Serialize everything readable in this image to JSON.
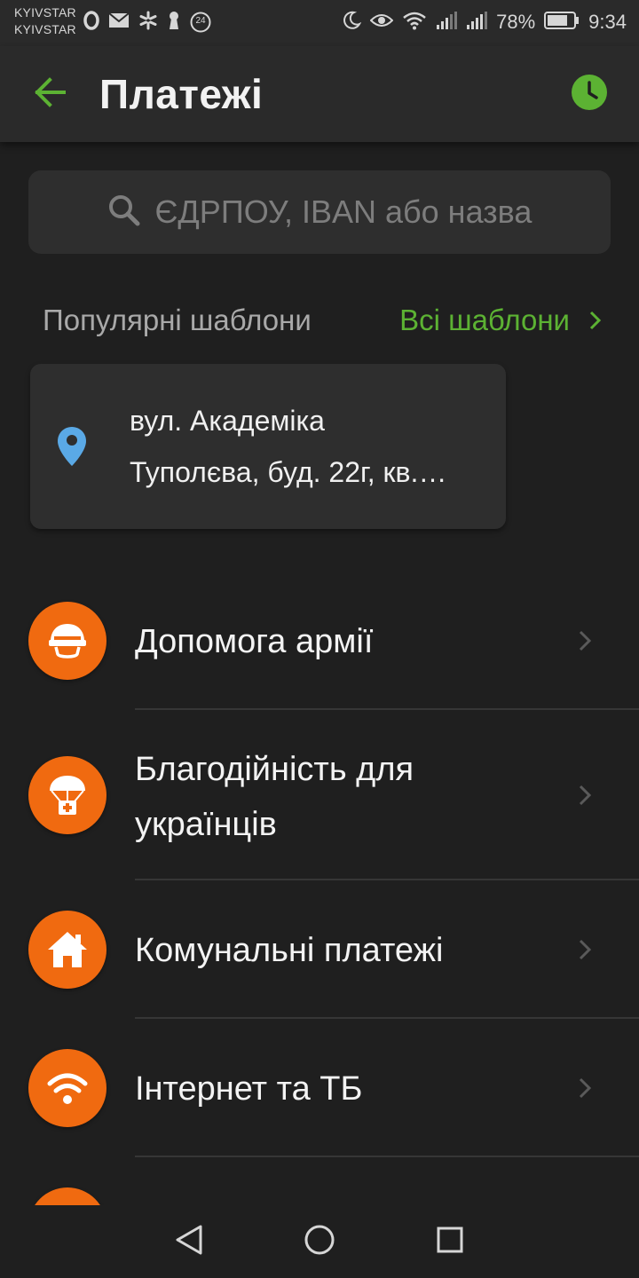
{
  "status_bar": {
    "carrier_1": "KYIVSTAR",
    "carrier_2": "KYIVSTAR",
    "notification_badge": "24",
    "battery_percent": "78%",
    "time": "9:34"
  },
  "app_bar": {
    "title": "Платежі",
    "accent_color": "#5cb233"
  },
  "search": {
    "placeholder": "ЄДРПОУ, IBAN або назва"
  },
  "templates": {
    "section_title": "Популярні шаблони",
    "all_link": "Всі шаблони",
    "items": [
      {
        "icon": "location-pin-icon",
        "line_1": "вул. Академіка",
        "line_2": "Туполєва, буд. 22г, кв.…"
      }
    ]
  },
  "categories": [
    {
      "icon": "helmet-icon",
      "label": "Допомога армії"
    },
    {
      "icon": "parachute-aid-icon",
      "label": "Благодійність для українців"
    },
    {
      "icon": "home-icon",
      "label": "Комунальні платежі"
    },
    {
      "icon": "wifi-icon",
      "label": "Інтернет та ТБ"
    }
  ],
  "colors": {
    "background": "#1f1f1f",
    "surface": "#2e2e2e",
    "category_icon": "#f06a10",
    "pin": "#5aa9e6"
  }
}
